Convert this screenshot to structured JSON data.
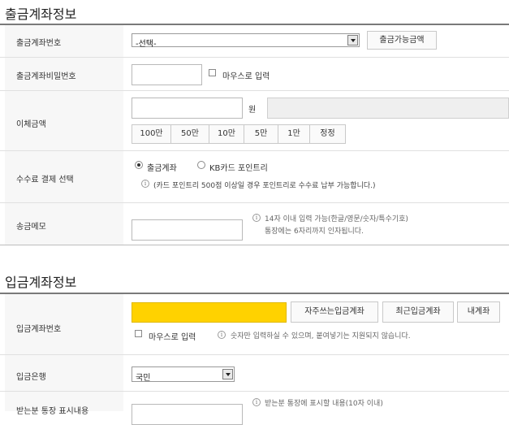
{
  "withdraw": {
    "title": "출금계좌정보",
    "account_label": "출금계좌번호",
    "account_select": "-선택-",
    "balance_button": "출금가능금액",
    "password_label": "출금계좌비밀번호",
    "mouse_input_label": "마우스로 입력",
    "amount_label": "이체금액",
    "won_unit": "원",
    "amount_buttons": [
      "100만",
      "50만",
      "10만",
      "5만",
      "1만",
      "정정"
    ],
    "fee_label": "수수료 결제 선택",
    "fee_option_account": "출금계좌",
    "fee_option_point": "KB카드 포인트리",
    "fee_note": "(카드 포인트리 500점 이상일 경우 포인트리로 수수료 납부 가능합니다.)",
    "memo_label": "송금메모",
    "memo_note_line1": "14자 이내 입력 가능(한글/영문/숫자/특수기호)",
    "memo_note_line2": "통장에는 6자리까지 인자됩니다."
  },
  "deposit": {
    "title": "입금계좌정보",
    "account_label": "입금계좌번호",
    "favorite_button": "자주쓰는입금계좌",
    "recent_button": "최근입금계좌",
    "my_account_button": "내계좌",
    "mouse_input_label": "마우스로 입력",
    "digits_note": "숫자만 입력하실 수 있으며, 붙여넣기는 지원되지 않습니다.",
    "bank_label": "입금은행",
    "bank_select": "국민",
    "display_label": "받는분 통장 표시내용",
    "display_note": "받는분 통장에 표시할 내용(10자 이내)"
  },
  "colors": {
    "highlight_input": "#ffd200",
    "label_bg": "#f7f7f7"
  }
}
